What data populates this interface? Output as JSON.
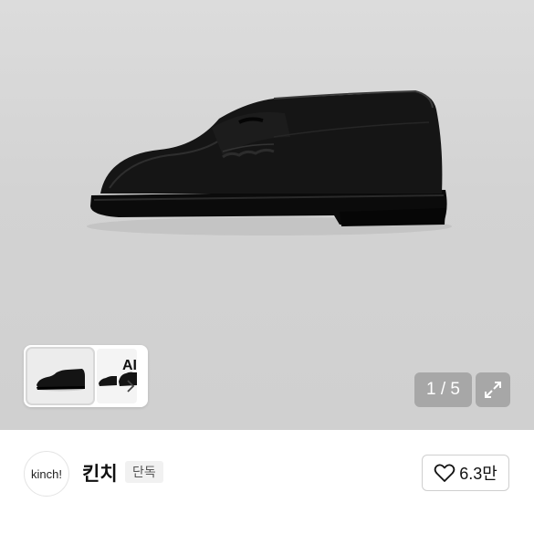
{
  "gallery": {
    "product_image": "black-penny-loafer-side-view",
    "thumbnails": [
      {
        "image": "loafer-single"
      },
      {
        "image": "loafer-pair"
      }
    ],
    "ai_label": "AI",
    "ai_icon": "chevron-right-icon",
    "counter": "1 / 5",
    "expand_icon": "expand-icon"
  },
  "seller": {
    "logo_text": "kinch!",
    "name": "킨치",
    "badge": "단독",
    "like_icon": "heart-outline-icon",
    "like_count": "6.3만"
  },
  "colors": {
    "gallery_background": "#d4d4d4",
    "shoe": "#111111",
    "overlay_button": "#a0a0a0"
  }
}
